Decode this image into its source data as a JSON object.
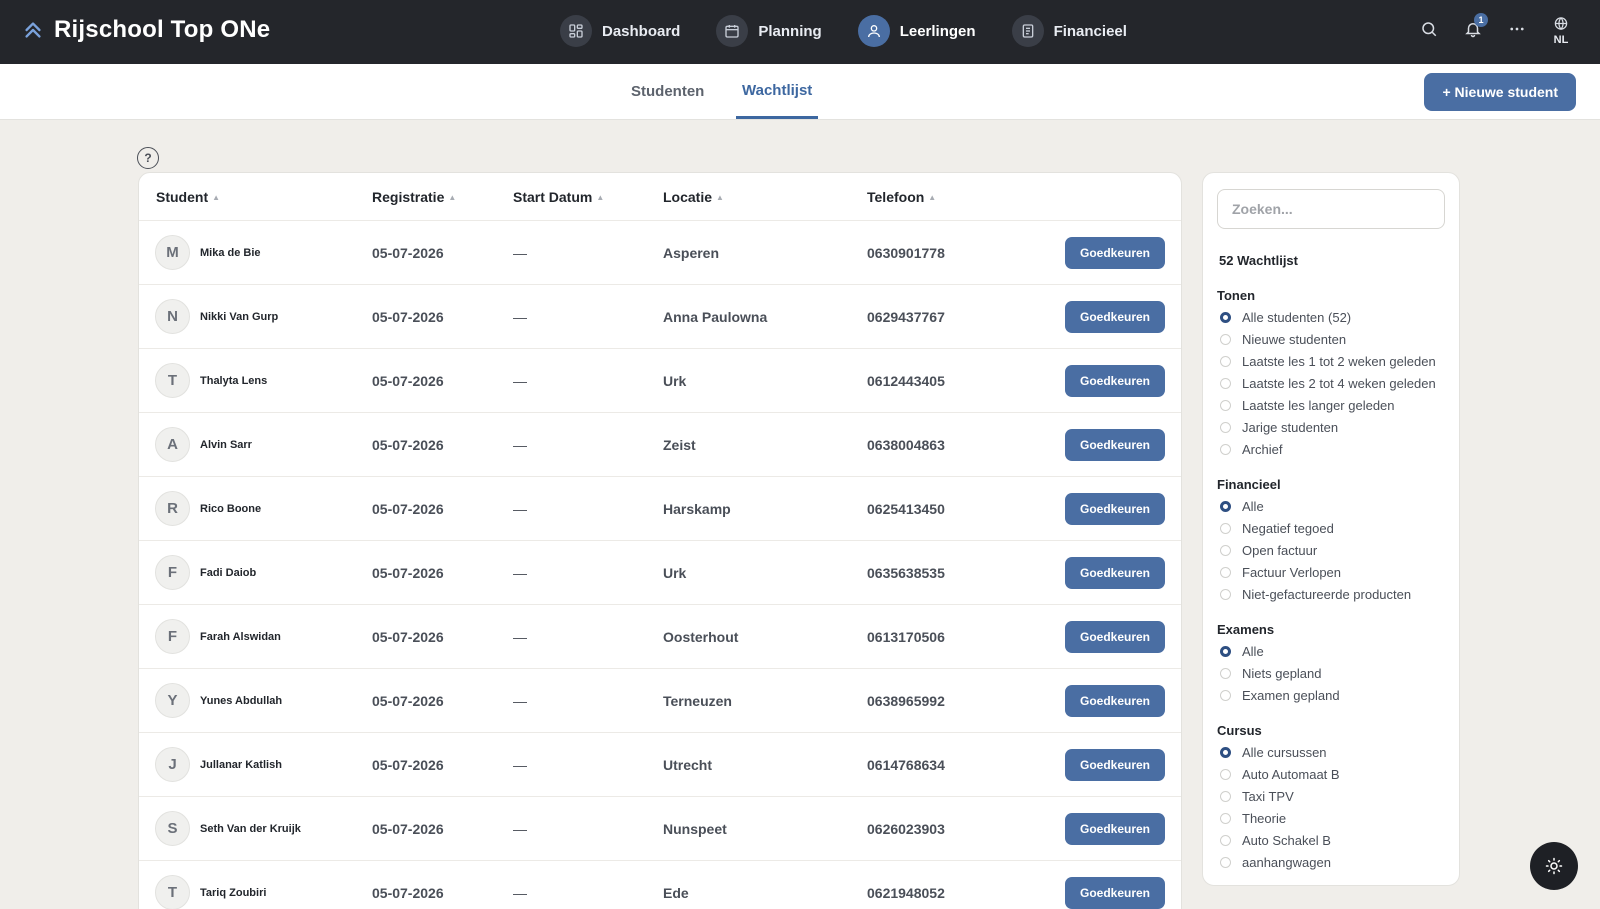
{
  "brand": {
    "title": "Rijschool Top ONe"
  },
  "nav": [
    {
      "label": "Dashboard",
      "icon": "grid-icon"
    },
    {
      "label": "Planning",
      "icon": "calendar-icon"
    },
    {
      "label": "Leerlingen",
      "icon": "user-icon",
      "active": true
    },
    {
      "label": "Financieel",
      "icon": "receipt-icon"
    }
  ],
  "top_actions": {
    "notifications_count": "1",
    "language": "NL"
  },
  "tabs": {
    "students": "Studenten",
    "waitlist": "Wachtlijst"
  },
  "new_student_label": "+ Nieuwe student",
  "table": {
    "headers": {
      "student": "Student",
      "registration": "Registratie",
      "start": "Start Datum",
      "location": "Locatie",
      "phone": "Telefoon"
    },
    "sort_arrow": "▲",
    "approve_label": "Goedkeuren",
    "rows": [
      {
        "initial": "M",
        "name": "Mika de Bie",
        "registration": "05-07-2026",
        "start": "—",
        "location": "Asperen",
        "phone": "0630901778"
      },
      {
        "initial": "N",
        "name": "Nikki Van Gurp",
        "registration": "05-07-2026",
        "start": "—",
        "location": "Anna Paulowna",
        "phone": "0629437767"
      },
      {
        "initial": "T",
        "name": "Thalyta Lens",
        "registration": "05-07-2026",
        "start": "—",
        "location": "Urk",
        "phone": "0612443405"
      },
      {
        "initial": "A",
        "name": "Alvin Sarr",
        "registration": "05-07-2026",
        "start": "—",
        "location": "Zeist",
        "phone": "0638004863"
      },
      {
        "initial": "R",
        "name": "Rico Boone",
        "registration": "05-07-2026",
        "start": "—",
        "location": "Harskamp",
        "phone": "0625413450"
      },
      {
        "initial": "F",
        "name": "Fadi Daiob",
        "registration": "05-07-2026",
        "start": "—",
        "location": "Urk",
        "phone": "0635638535"
      },
      {
        "initial": "F",
        "name": "Farah Alswidan",
        "registration": "05-07-2026",
        "start": "—",
        "location": "Oosterhout",
        "phone": "0613170506"
      },
      {
        "initial": "Y",
        "name": "Yunes Abdullah",
        "registration": "05-07-2026",
        "start": "—",
        "location": "Terneuzen",
        "phone": "0638965992"
      },
      {
        "initial": "J",
        "name": "Jullanar Katlish",
        "registration": "05-07-2026",
        "start": "—",
        "location": "Utrecht",
        "phone": "0614768634"
      },
      {
        "initial": "S",
        "name": "Seth Van der Kruijk",
        "registration": "05-07-2026",
        "start": "—",
        "location": "Nunspeet",
        "phone": "0626023903"
      },
      {
        "initial": "T",
        "name": "Tariq Zoubiri",
        "registration": "05-07-2026",
        "start": "—",
        "location": "Ede",
        "phone": "0621948052"
      }
    ]
  },
  "filters": {
    "search_placeholder": "Zoeken...",
    "count_label": "52 Wachtlijst",
    "groups": [
      {
        "title": "Tonen",
        "options": [
          "Alle studenten (52)",
          "Nieuwe studenten",
          "Laatste les 1 tot 2 weken geleden",
          "Laatste les 2 tot 4 weken geleden",
          "Laatste les langer geleden",
          "Jarige studenten",
          "Archief"
        ],
        "selected": 0
      },
      {
        "title": "Financieel",
        "options": [
          "Alle",
          "Negatief tegoed",
          "Open factuur",
          "Factuur Verlopen",
          "Niet-gefactureerde producten"
        ],
        "selected": 0
      },
      {
        "title": "Examens",
        "options": [
          "Alle",
          "Niets gepland",
          "Examen gepland"
        ],
        "selected": 0
      },
      {
        "title": "Cursus",
        "options": [
          "Alle cursussen",
          "Auto Automaat B",
          "Taxi TPV",
          "Theorie",
          "Auto Schakel B",
          "aanhangwagen"
        ],
        "selected": 0
      }
    ]
  },
  "colors": {
    "accent": "#4a6ea3",
    "topbar": "#24262b",
    "background": "#f0eeea"
  }
}
